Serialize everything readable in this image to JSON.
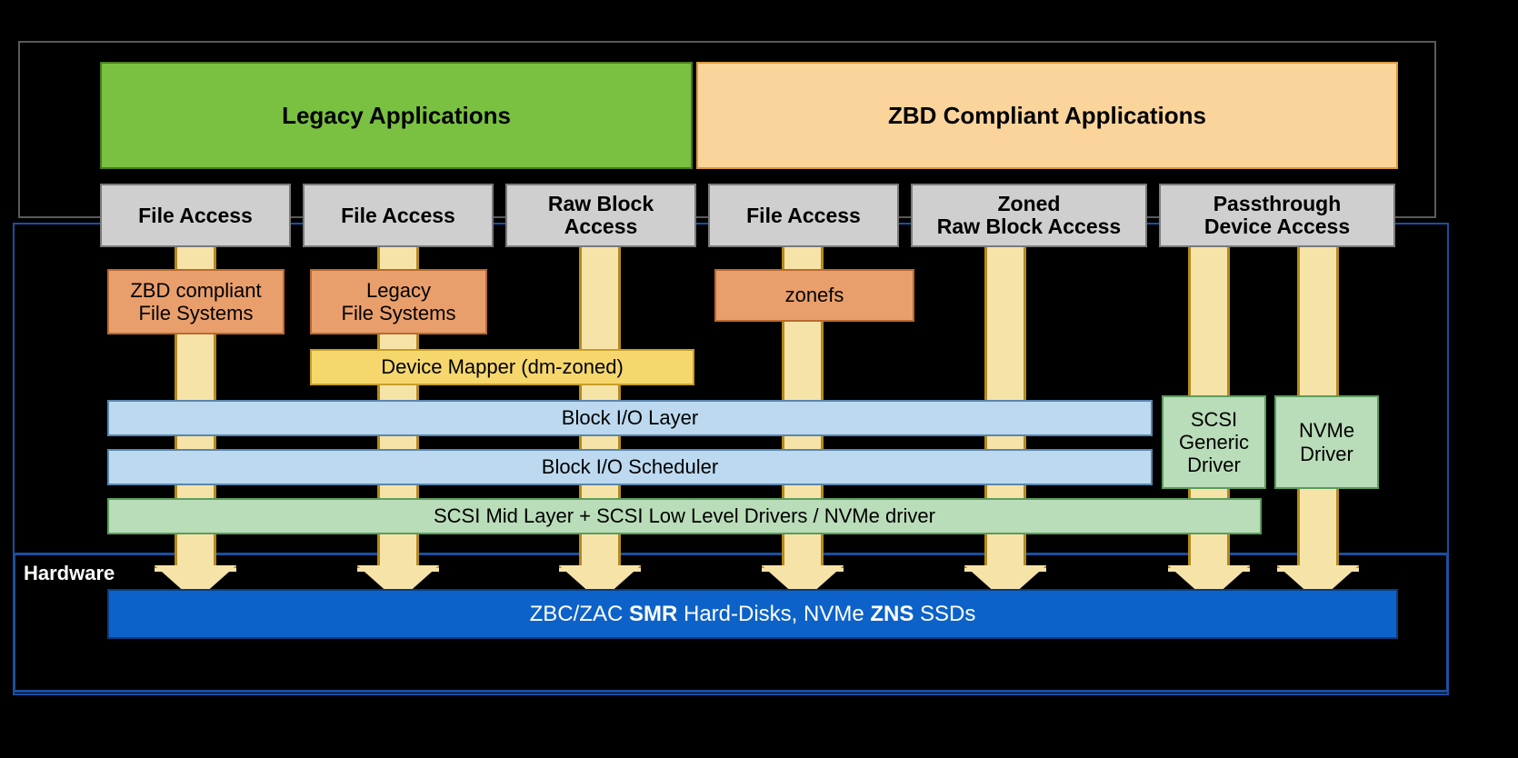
{
  "diagram": {
    "apps": {
      "legacy": "Legacy Applications",
      "zbd": "ZBD Compliant Applications"
    },
    "access": {
      "a1": "File Access",
      "a2": "File Access",
      "a3": "Raw Block\nAccess",
      "a4": "File Access",
      "a5": "Zoned\nRaw Block Access",
      "a6": "Passthrough\nDevice Access"
    },
    "fs": {
      "zbd_fs": "ZBD compliant\nFile Systems",
      "legacy_fs": "Legacy\nFile Systems",
      "zonefs": "zonefs"
    },
    "dm": "Device Mapper (dm-zoned)",
    "blk_layer": "Block I/O Layer",
    "blk_sched": "Block I/O Scheduler",
    "scsi_mid": "SCSI Mid Layer + SCSI Low Level Drivers / NVMe driver",
    "scsi_generic": "SCSI\nGeneric\nDriver",
    "nvme_drv": "NVMe\nDriver",
    "hw_label": "Hardware",
    "hw_bar_prefix": "ZBC/ZAC ",
    "hw_bar_b1": "SMR",
    "hw_bar_mid": " Hard-Disks, NVMe ",
    "hw_bar_b2": "ZNS",
    "hw_bar_suffix": " SSDs"
  },
  "colors": {
    "arrow_fill": "#f6e3a8",
    "arrow_stroke": "#b48a1e"
  }
}
